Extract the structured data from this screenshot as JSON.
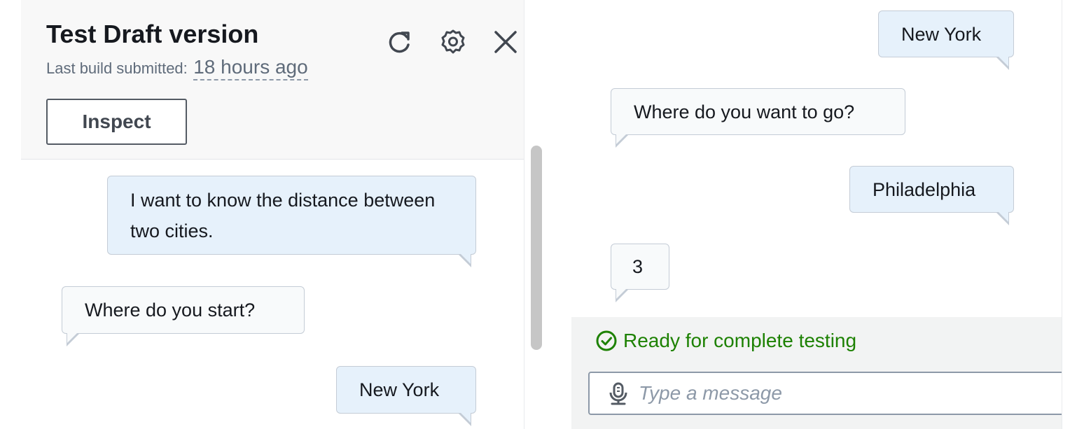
{
  "header": {
    "title": "Test Draft version",
    "build_label": "Last build submitted:",
    "build_time": "18 hours ago",
    "inspect_label": "Inspect"
  },
  "icons": {
    "refresh": "refresh-icon",
    "settings": "gear-icon",
    "close": "close-icon",
    "status": "check-circle-icon",
    "microphone": "microphone-icon"
  },
  "left_conversation": [
    {
      "role": "user",
      "text": "I want to know the distance between two cities."
    },
    {
      "role": "bot",
      "text": "Where do you start?"
    },
    {
      "role": "user",
      "text": "New York"
    }
  ],
  "right_conversation": [
    {
      "role": "user",
      "text": "New York"
    },
    {
      "role": "bot",
      "text": "Where do you want to go?"
    },
    {
      "role": "user",
      "text": "Philadelphia"
    },
    {
      "role": "bot",
      "text": "3"
    }
  ],
  "status": {
    "text": "Ready for complete testing",
    "color": "#1d8102"
  },
  "composer": {
    "placeholder": "Type a message"
  },
  "colors": {
    "user_bubble": "#e6f1fb",
    "bot_bubble": "#f8fafb",
    "header_bg": "#f8f8f8"
  }
}
